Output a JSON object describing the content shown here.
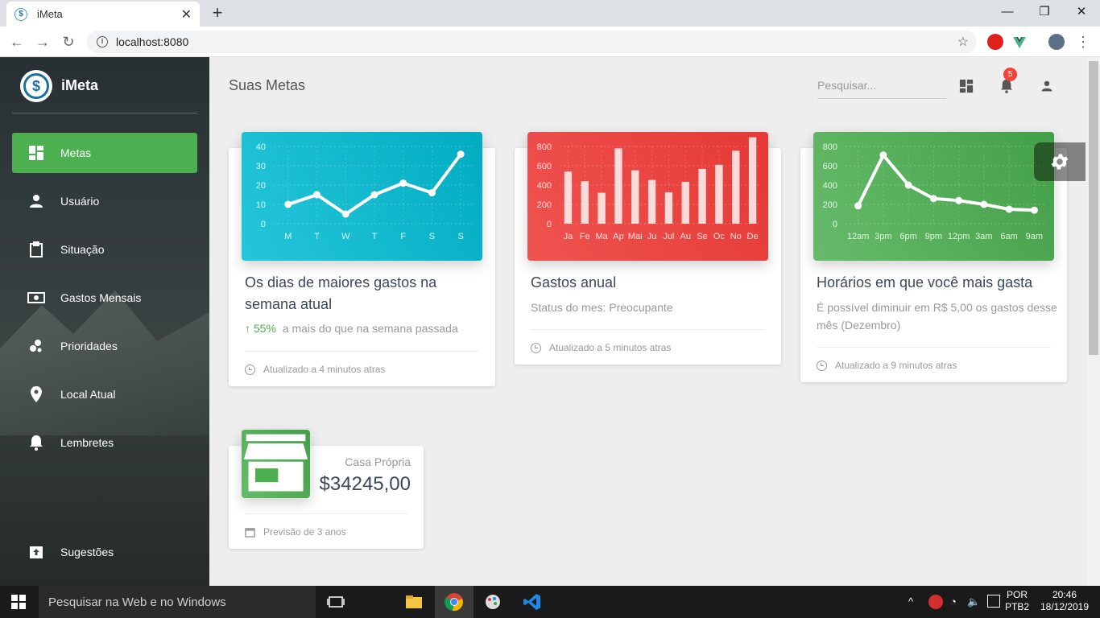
{
  "browser": {
    "tab_title": "iMeta",
    "tab_icon": "dollar-favicon-icon",
    "url": "localhost:8080",
    "minimize": "—",
    "maximize": "❐",
    "close": "✕"
  },
  "sidebar": {
    "brand": "iMeta",
    "items": [
      {
        "label": "Metas",
        "icon": "dashboard-icon",
        "active": true
      },
      {
        "label": "Usuário",
        "icon": "person-icon"
      },
      {
        "label": "Situação",
        "icon": "clipboard-icon"
      },
      {
        "label": "Gastos Mensais",
        "icon": "money-icon"
      },
      {
        "label": "Prioridades",
        "icon": "bubble-chart-icon"
      },
      {
        "label": "Local Atual",
        "icon": "location-icon"
      },
      {
        "label": "Lembretes",
        "icon": "bell-icon"
      },
      {
        "label": "Sugestões",
        "icon": "unarchive-icon"
      }
    ]
  },
  "header": {
    "title": "Suas Metas",
    "search_placeholder": "Pesquisar...",
    "notification_count": "5"
  },
  "cards": [
    {
      "title": "Os dias de maiores gastos na semana atual",
      "stat_value": "55%",
      "stat_text": "a mais do que na semana passada",
      "footer": "Atualizado a 4 minutos atras",
      "color": "#26c6da"
    },
    {
      "title": "Gastos anual",
      "category": "Status do mes: Preocupante",
      "footer": "Atualizado a 5 minutos atras",
      "color": "#ef5350"
    },
    {
      "title": "Horários em que você mais gasta",
      "category": "É possível diminuir em R$ 5,00 os gastos desse mês (Dezembro)",
      "footer": "Atualizado a 9 minutos atras",
      "color": "#66bb6a"
    }
  ],
  "stat_card": {
    "category": "Casa Própria",
    "value": "$34245,00",
    "footer": "Previsão de 3 anos",
    "icon": "store-icon"
  },
  "chart_data": [
    {
      "type": "line",
      "x": [
        "M",
        "T",
        "W",
        "T",
        "F",
        "S",
        "S"
      ],
      "series": [
        {
          "values": [
            10,
            15,
            5,
            15,
            21,
            16,
            36
          ]
        }
      ],
      "ylim": [
        0,
        40
      ],
      "yticks": [
        0,
        10,
        20,
        30,
        40
      ]
    },
    {
      "type": "bar",
      "categories": [
        "Ja",
        "Fe",
        "Ma",
        "Ap",
        "Mai",
        "Ju",
        "Jul",
        "Au",
        "Se",
        "Oc",
        "No",
        "De"
      ],
      "values": [
        540,
        440,
        320,
        780,
        553,
        453,
        326,
        434,
        568,
        610,
        756,
        895
      ],
      "ylim": [
        0,
        800
      ],
      "yticks": [
        0,
        200,
        400,
        600,
        800
      ]
    },
    {
      "type": "line",
      "x": [
        "12am",
        "3pm",
        "6pm",
        "9pm",
        "12pm",
        "3am",
        "6am",
        "9am"
      ],
      "series": [
        {
          "values": [
            185,
            710,
            400,
            260,
            240,
            200,
            150,
            140
          ]
        }
      ],
      "ylim": [
        0,
        800
      ],
      "yticks": [
        0,
        200,
        400,
        600,
        800
      ]
    }
  ],
  "taskbar": {
    "search_placeholder": "Pesquisar na Web e no Windows",
    "lang_top": "POR",
    "lang_bottom": "PTB2",
    "time": "20:46",
    "date": "18/12/2019"
  }
}
